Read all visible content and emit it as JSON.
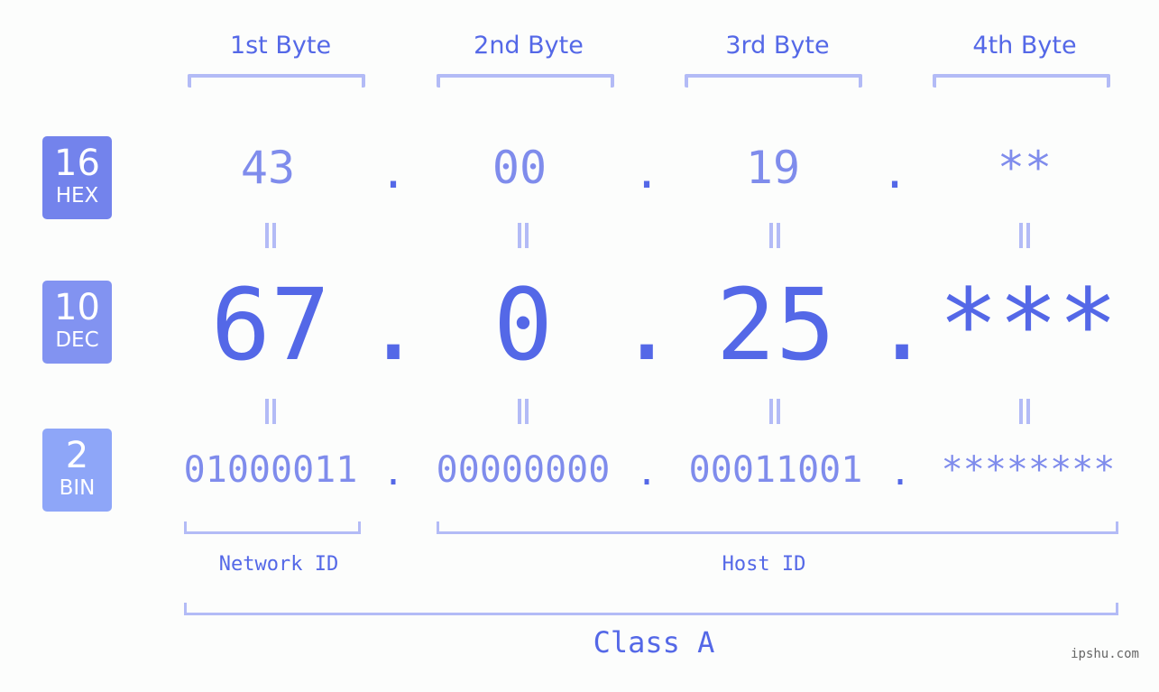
{
  "bytes": {
    "headers": [
      "1st Byte",
      "2nd Byte",
      "3rd Byte",
      "4th Byte"
    ]
  },
  "bases": [
    {
      "number": "16",
      "label": "HEX",
      "color": "#7383ec"
    },
    {
      "number": "10",
      "label": "DEC",
      "color": "#8293f1"
    },
    {
      "number": "2",
      "label": "BIN",
      "color": "#8ea6f8"
    }
  ],
  "hex": [
    "43",
    "00",
    "19",
    "**"
  ],
  "dec": [
    "67",
    "0",
    "25",
    "***"
  ],
  "bin": [
    "01000011",
    "00000000",
    "00011001",
    "********"
  ],
  "separator": ".",
  "equals": "||",
  "segments": {
    "network_id": "Network ID",
    "host_id": "Host ID"
  },
  "class_label": "Class A",
  "watermark": "ipshu.com",
  "colors": {
    "primary": "#5468e7",
    "secondary": "#7f8cec",
    "bracket": "#b3bbf6"
  }
}
